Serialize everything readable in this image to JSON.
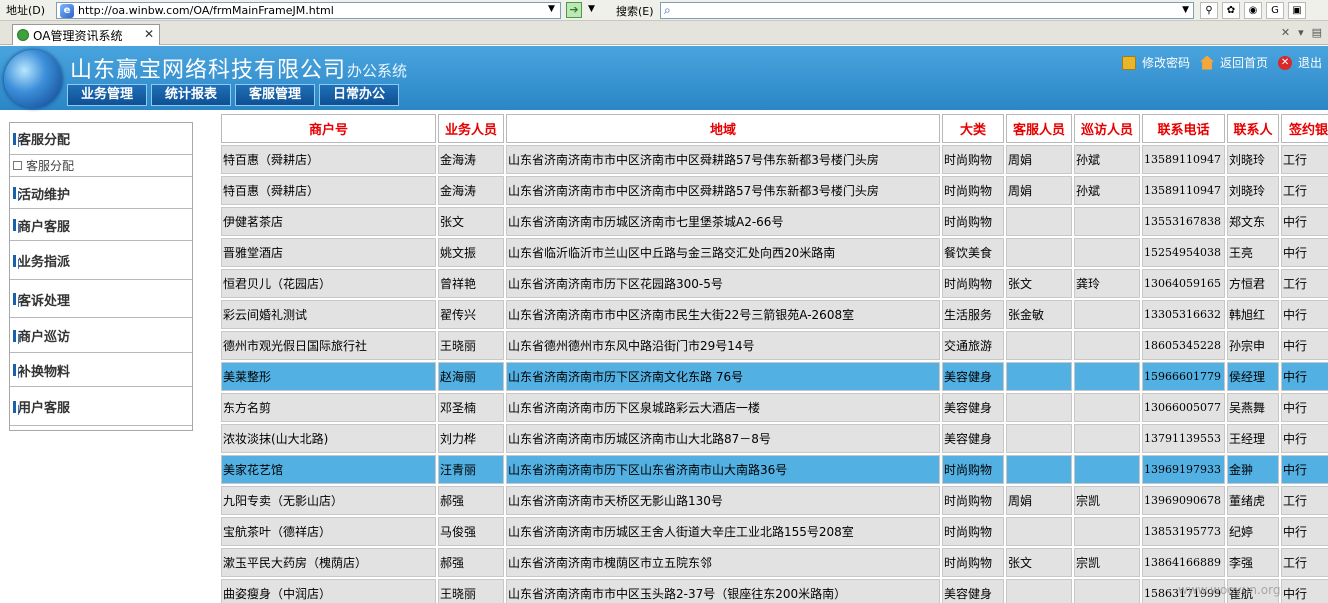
{
  "browser": {
    "address_label": "地址(D)",
    "url": "http://oa.winbw.com/OA/frmMainFrameJM.html",
    "search_label": "搜索(E)",
    "tab_title": "OA管理资讯系统",
    "tab_close": "✕"
  },
  "header": {
    "title": "山东赢宝网络科技有限公司",
    "subtitle": "办公系统",
    "nav": [
      "业务管理",
      "统计报表",
      "客服管理",
      "日常办公"
    ],
    "change_password": "修改密码",
    "home": "返回首页",
    "logout": "退出"
  },
  "sidebar": {
    "items": [
      "客服分配",
      "活动维护",
      "商户客服",
      "业务指派",
      "客诉处理",
      "商户巡访",
      "补换物料",
      "用户客服"
    ],
    "sub_item": "客服分配"
  },
  "table": {
    "headers": [
      "商户号",
      "业务人员",
      "地域",
      "大类",
      "客服人员",
      "巡访人员",
      "联系电话",
      "联系人",
      "签约银行"
    ],
    "rows": [
      {
        "merchant": "特百惠（舜耕店）",
        "sales": "金海涛",
        "region": "山东省济南济南市市中区济南市中区舜耕路57号伟东新都3号楼门头房",
        "category": "时尚购物",
        "service": "周娟",
        "visit": "孙斌",
        "phone": "13589110947",
        "contact": "刘晓玲",
        "bank": "工行",
        "highlight": false
      },
      {
        "merchant": "特百惠（舜耕店）",
        "sales": "金海涛",
        "region": "山东省济南济南市市中区济南市中区舜耕路57号伟东新都3号楼门头房",
        "category": "时尚购物",
        "service": "周娟",
        "visit": "孙斌",
        "phone": "13589110947",
        "contact": "刘晓玲",
        "bank": "工行",
        "highlight": false
      },
      {
        "merchant": "伊健茗茶店",
        "sales": "张文",
        "region": "山东省济南济南市历城区济南市七里堡茶城A2-66号",
        "category": "时尚购物",
        "service": "",
        "visit": "",
        "phone": "13553167838",
        "contact": "郑文东",
        "bank": "中行",
        "highlight": false
      },
      {
        "merchant": "晋雅堂酒店",
        "sales": "姚文振",
        "region": "山东省临沂临沂市兰山区中丘路与金三路交汇处向西20米路南",
        "category": "餐饮美食",
        "service": "",
        "visit": "",
        "phone": "15254954038",
        "contact": "王亮",
        "bank": "中行",
        "highlight": false
      },
      {
        "merchant": "恒君贝儿（花园店）",
        "sales": "曾祥艳",
        "region": "山东省济南济南市历下区花园路300-5号",
        "category": "时尚购物",
        "service": "张文",
        "visit": "龚玲",
        "phone": "13064059165",
        "contact": "方恒君",
        "bank": "工行",
        "highlight": false
      },
      {
        "merchant": "彩云间婚礼测试",
        "sales": "翟传兴",
        "region": "山东省济南济南市市中区济南市民生大街22号三箭银苑A-2608室",
        "category": "生活服务",
        "service": "张金敏",
        "visit": "",
        "phone": "13305316632",
        "contact": "韩旭红",
        "bank": "中行",
        "highlight": false
      },
      {
        "merchant": "德州市观光假日国际旅行社",
        "sales": "王晓丽",
        "region": "山东省德州德州市东风中路沿街门市29号14号",
        "category": "交通旅游",
        "service": "",
        "visit": "",
        "phone": "18605345228",
        "contact": "孙宗申",
        "bank": "中行",
        "highlight": false
      },
      {
        "merchant": "美莱整形",
        "sales": "赵海丽",
        "region": "山东省济南济南市历下区济南文化东路  76号",
        "category": "美容健身",
        "service": "",
        "visit": "",
        "phone": "15966601779",
        "contact": "侯经理",
        "bank": "中行",
        "highlight": true
      },
      {
        "merchant": "东方名剪",
        "sales": "邓圣楠",
        "region": "山东省济南济南市历下区泉城路彩云大酒店一楼",
        "category": "美容健身",
        "service": "",
        "visit": "",
        "phone": "13066005077",
        "contact": "吴燕舞",
        "bank": "中行",
        "highlight": false
      },
      {
        "merchant": "浓妆淡抹(山大北路)",
        "sales": "刘力桦",
        "region": "山东省济南济南市历城区济南市山大北路87－8号",
        "category": "美容健身",
        "service": "",
        "visit": "",
        "phone": "13791139553",
        "contact": "王经理",
        "bank": "中行",
        "highlight": false
      },
      {
        "merchant": "美家花艺馆",
        "sales": "汪青丽",
        "region": "山东省济南济南市历下区山东省济南市山大南路36号",
        "category": "时尚购物",
        "service": "",
        "visit": "",
        "phone": "13969197933",
        "contact": "金翀",
        "bank": "中行",
        "highlight": true
      },
      {
        "merchant": "九阳专卖（无影山店）",
        "sales": "郝强",
        "region": "山东省济南济南市天桥区无影山路130号",
        "category": "时尚购物",
        "service": "周娟",
        "visit": "宗凯",
        "phone": "13969090678",
        "contact": "董绪虎",
        "bank": "工行",
        "highlight": false
      },
      {
        "merchant": "宝航茶叶（德祥店）",
        "sales": "马俊强",
        "region": "山东省济南济南市历城区王舍人街道大辛庄工业北路155号208室",
        "category": "时尚购物",
        "service": "",
        "visit": "",
        "phone": "13853195773",
        "contact": "纪婷",
        "bank": "中行",
        "highlight": false
      },
      {
        "merchant": "漱玉平民大药房（槐荫店）",
        "sales": "郝强",
        "region": "山东省济南济南市槐荫区市立五院东邻",
        "category": "时尚购物",
        "service": "张文",
        "visit": "宗凯",
        "phone": "13864166889",
        "contact": "李强",
        "bank": "工行",
        "highlight": false
      },
      {
        "merchant": "曲姿瘦身（中润店）",
        "sales": "王晓丽",
        "region": "山东省济南济南市市中区玉头路2-37号（银座往东200米路南）",
        "category": "美容健身",
        "service": "",
        "visit": "",
        "phone": "15863171999",
        "contact": "崔航",
        "bank": "中行",
        "highlight": false
      }
    ]
  },
  "watermark": "www.wooyun.org",
  "colors": {
    "header_blue": "#3a97d4",
    "highlight_row": "#52b0e2",
    "header_text_red": "#e80000"
  }
}
